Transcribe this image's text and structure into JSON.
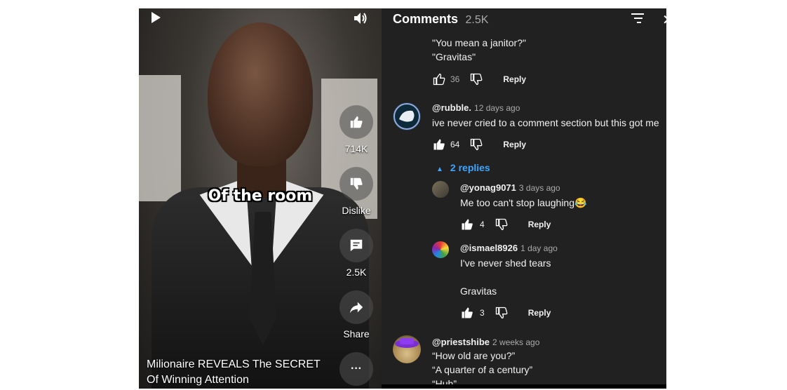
{
  "video": {
    "caption": "Of the room",
    "title_line1": "Milionaire REVEALS The SECRET",
    "title_line2": "Of Winning Attention",
    "like_count": "714K",
    "dislike_label": "Dislike",
    "comment_count": "2.5K",
    "share_label": "Share",
    "more_label": "···"
  },
  "comments_panel": {
    "title": "Comments",
    "count": "2.5K",
    "items": [
      {
        "line1": "\"You mean a janitor?\"",
        "line2": "\"Gravitas\"",
        "likes": "36",
        "reply": "Reply"
      },
      {
        "handle": "@rubble.",
        "ago": "12 days ago",
        "text": "ive never cried to a comment section but this got me",
        "likes": "64",
        "reply": "Reply",
        "replies_toggle": "2 replies"
      },
      {
        "handle": "@yonag9071",
        "ago": "3 days ago",
        "text": "Me too can't stop laughing",
        "emoji": "😂",
        "likes": "4",
        "reply": "Reply"
      },
      {
        "handle": "@ismael8926",
        "ago": "1 day ago",
        "line1": "I've never shed tears",
        "line2": "Gravitas",
        "likes": "3",
        "reply": "Reply"
      },
      {
        "handle": "@priestshibe",
        "ago": "2 weeks ago",
        "line1": "“How old are you?”",
        "line2": "“A quarter of a century”",
        "line3": "“Huh”"
      }
    ]
  },
  "colors": {
    "panel_bg": "#212121",
    "accent_blue": "#3ea6ff",
    "muted": "#aaaaaa"
  },
  "icons": [
    "play-icon",
    "volume-icon",
    "thumb-up-icon",
    "thumb-down-icon",
    "comment-icon",
    "share-icon",
    "more-icon",
    "sort-icon",
    "close-icon"
  ]
}
